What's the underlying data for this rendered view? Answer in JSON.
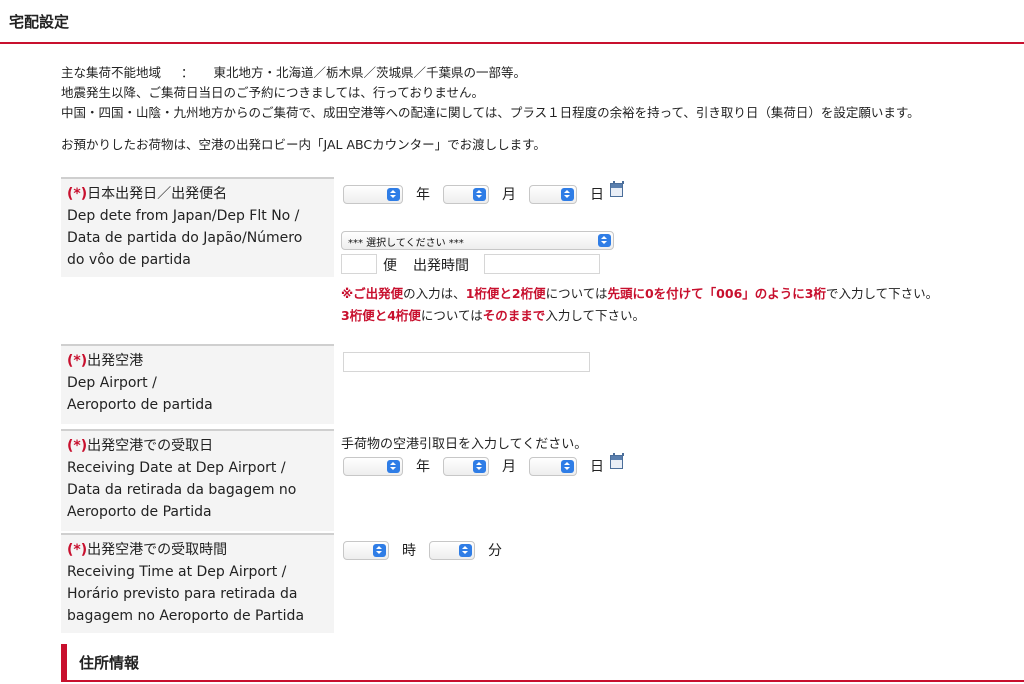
{
  "section_title": "宅配設定",
  "notes": {
    "line1_label": "主な集荷不能地域",
    "line1_sep": "：",
    "line1_value": "東北地方・北海道／栃木県／茨城県／千葉県の一部等。",
    "line2": "地震発生以降、ご集荷日当日のご予約につきましては、行っておりません。",
    "line3": "中国・四国・山陰・九州地方からのご集荷で、成田空港等への配達に関しては、プラス１日程度の余裕を持って、引き取り日（集荷日）を設定願います。",
    "line4": "お預かりしたお荷物は、空港の出発ロビー内「JAL ABCカウンター」でお渡しします。"
  },
  "fields": {
    "dep_date": {
      "required_mark": "(*)",
      "label_ja": "日本出発日／出発便名",
      "label_en": "Dep dete from Japan/Dep Flt No /",
      "label_pt1": "Data de partida do Japão/Número",
      "label_pt2": "do vôo de partida",
      "year_unit": "年",
      "month_unit": "月",
      "day_unit": "日",
      "airline_select": "*** 選択してください ***",
      "flight_unit": "便",
      "dep_time_label": "出発時間"
    },
    "warning": {
      "w1": "※",
      "w2": "ご出発便",
      "w3": "の入力は、",
      "w4": "1桁便と2桁便",
      "w5": "については",
      "w6": "先頭に0を付けて「006」のように3桁",
      "w7": "で入力して下さい。",
      "w8": "3桁便と4桁便",
      "w9": "については",
      "w10": "そのままで",
      "w11": "入力して下さい。"
    },
    "dep_airport": {
      "required_mark": "(*)",
      "label_ja": "出発空港",
      "label_en": "Dep Airport /",
      "label_pt": "Aeroporto de partida"
    },
    "receiving_date": {
      "required_mark": "(*)",
      "label_ja": "出発空港での受取日",
      "label_en": "Receiving Date at Dep Airport /",
      "label_pt1": "Data da retirada da bagagem no",
      "label_pt2": "Aeroporto de Partida",
      "helper": "手荷物の空港引取日を入力してください。",
      "year_unit": "年",
      "month_unit": "月",
      "day_unit": "日"
    },
    "receiving_time": {
      "required_mark": "(*)",
      "label_ja": "出発空港での受取時間",
      "label_en": "Receiving Time at Dep Airport /",
      "label_pt1": "Horário previsto para retirada da",
      "label_pt2": "bagagem no Aeroporto de Partida",
      "hour_unit": "時",
      "minute_unit": "分"
    }
  },
  "address_section_title": "住所情報",
  "colors": {
    "accent": "#c8102e",
    "select_arrow": "#2f7de6",
    "label_bg": "#f4f4f4"
  },
  "icons": [
    "calendar-icon",
    "select-arrow-icon"
  ]
}
